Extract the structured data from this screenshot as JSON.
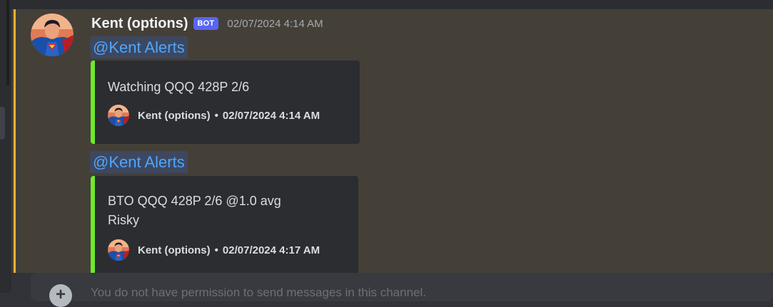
{
  "message": {
    "author": "Kent (options)",
    "bot_tag": "BOT",
    "timestamp": "02/07/2024 4:14 AM",
    "avatar_icon": "superman-avatar",
    "mention_color": "#f0b132",
    "embed_color": "#6ee92a"
  },
  "posts": [
    {
      "mention": "@Kent Alerts",
      "embed": {
        "description_lines": [
          "Watching QQQ 428P 2/6"
        ],
        "footer_author": "Kent (options)",
        "footer_separator": "•",
        "footer_time": "02/07/2024 4:14 AM"
      }
    },
    {
      "mention": "@Kent Alerts",
      "embed": {
        "description_lines": [
          "BTO QQQ 428P 2/6 @1.0 avg",
          "Risky"
        ],
        "footer_author": "Kent (options)",
        "footer_separator": "•",
        "footer_time": "02/07/2024 4:17 AM"
      }
    }
  ],
  "composer": {
    "plus_icon": "plus-circle-icon",
    "placeholder": "You do not have permission to send messages in this channel."
  }
}
